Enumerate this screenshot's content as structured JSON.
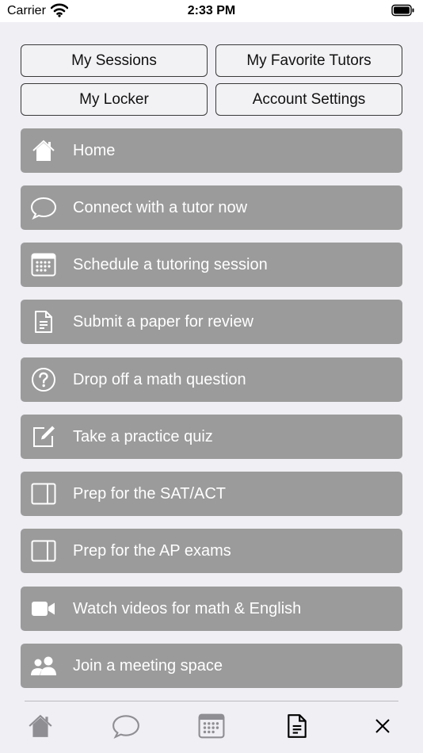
{
  "status_bar": {
    "carrier": "Carrier",
    "time": "2:33 PM"
  },
  "top_buttons": {
    "my_sessions": "My Sessions",
    "my_favorite_tutors": "My Favorite Tutors",
    "my_locker": "My Locker",
    "account_settings": "Account Settings"
  },
  "menu": {
    "items": [
      {
        "label": "Home",
        "icon": "home-icon"
      },
      {
        "label": "Connect with a tutor now",
        "icon": "chat-bubble-icon"
      },
      {
        "label": "Schedule a tutoring session",
        "icon": "calendar-icon"
      },
      {
        "label": "Submit a paper for review",
        "icon": "document-icon"
      },
      {
        "label": "Drop off a math question",
        "icon": "question-circle-icon"
      },
      {
        "label": "Take a practice quiz",
        "icon": "pencil-square-icon"
      },
      {
        "label": "Prep for the SAT/ACT",
        "icon": "panel-icon"
      },
      {
        "label": "Prep for the AP exams",
        "icon": "panel-icon"
      },
      {
        "label": "Watch videos for math & English",
        "icon": "video-camera-icon"
      },
      {
        "label": "Join a meeting space",
        "icon": "people-icon"
      }
    ]
  },
  "tab_bar": {
    "tabs": [
      "home-icon",
      "chat-bubble-icon",
      "calendar-icon",
      "document-icon",
      "close-icon"
    ],
    "active_tab": "document-icon"
  },
  "colors": {
    "menu_bg": "#9b9b9b",
    "page_bg": "#efeff4",
    "tab_inactive": "#8e8e93"
  }
}
